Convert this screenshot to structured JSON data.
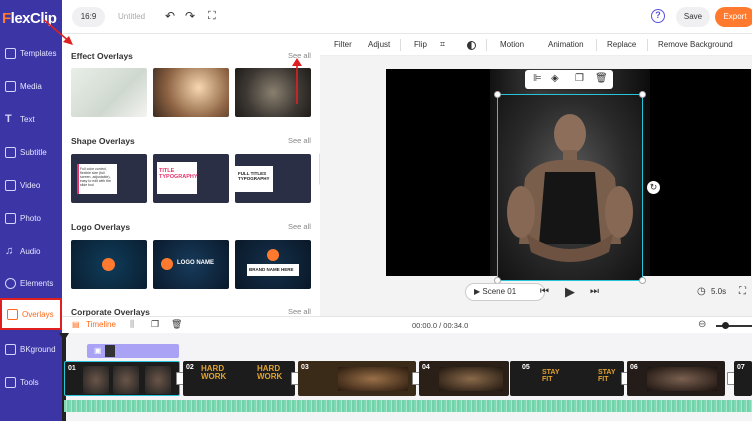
{
  "brand": {
    "logo_first": "F",
    "logo_rest": "lexClip"
  },
  "topbar": {
    "ratio": "16:9",
    "title": "Untitled",
    "help": "?",
    "save_label": "Save",
    "export_label": "Export"
  },
  "sidebar": {
    "items": [
      {
        "label": "Templates",
        "icon": "templates-icon"
      },
      {
        "label": "Media",
        "icon": "media-icon"
      },
      {
        "label": "Text",
        "icon": "text-icon"
      },
      {
        "label": "Subtitle",
        "icon": "subtitle-icon"
      },
      {
        "label": "Video",
        "icon": "video-icon"
      },
      {
        "label": "Photo",
        "icon": "photo-icon"
      },
      {
        "label": "Audio",
        "icon": "audio-icon"
      },
      {
        "label": "Elements",
        "icon": "elements-icon"
      },
      {
        "label": "Overlays",
        "icon": "overlays-icon",
        "active": true
      },
      {
        "label": "BKground",
        "icon": "background-icon"
      },
      {
        "label": "Tools",
        "icon": "tools-icon"
      }
    ]
  },
  "panel": {
    "sections": [
      {
        "title": "Effect Overlays",
        "see_all": "See all"
      },
      {
        "title": "Shape Overlays",
        "see_all": "See all",
        "thumbs": [
          "Full color control, flexible size (full screen, adjustable), easy to edit with the slide tool",
          "TITLE TYPOGRAPHY",
          "FULL TITLES TYPOGRAPHY"
        ]
      },
      {
        "title": "Logo Overlays",
        "see_all": "See all",
        "thumbs": [
          "",
          "LOGO NAME",
          "BRAND NAME HERE"
        ]
      },
      {
        "title": "Corporate Overlays",
        "see_all": "See all"
      }
    ]
  },
  "edit_toolbar": {
    "items": [
      "Filter",
      "Adjust",
      "Flip",
      "Motion",
      "Animation",
      "Replace",
      "Remove Background"
    ]
  },
  "player": {
    "scene_label": "Scene 01",
    "duration": "5.0s"
  },
  "timeline": {
    "tab_label": "Timeline",
    "time": "00:00.0 / 00:34.0",
    "clips": [
      {
        "num": "01",
        "text": ""
      },
      {
        "num": "02",
        "text": "HARD WORK"
      },
      {
        "num": "03",
        "text": "HARD WORK"
      },
      {
        "num": "04",
        "text": ""
      },
      {
        "num": "05",
        "text": "STAY FIT"
      },
      {
        "num": "06",
        "text": "STAY FIT"
      },
      {
        "num": "07",
        "text": ""
      }
    ]
  },
  "colors": {
    "sidebar": "#3b35a6",
    "accent": "#ff7a2e",
    "selection": "#29c4d9",
    "annotation": "#e02020",
    "audio_wave": "#7ed8b4"
  }
}
